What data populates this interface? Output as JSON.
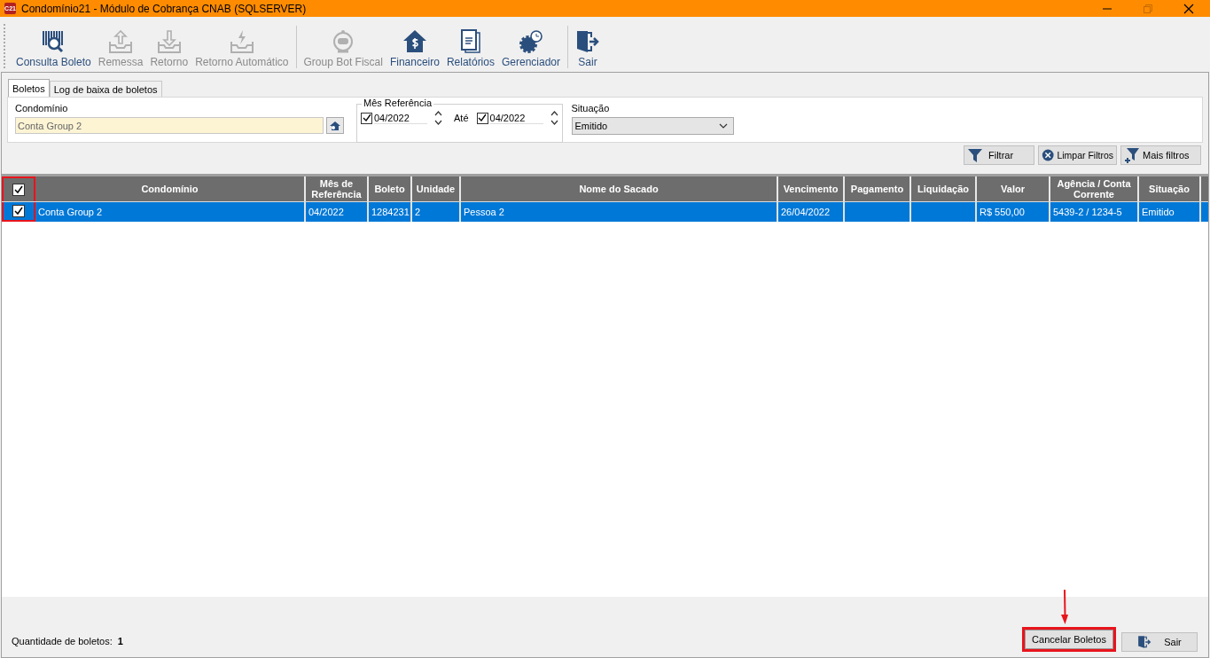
{
  "window": {
    "title": "Condomínio21 - Módulo de Cobrança CNAB (SQLSERVER)",
    "app_badge": "C21"
  },
  "toolbar": [
    {
      "label": "Consulta Boleto",
      "kind": "barcode",
      "disabled": false
    },
    {
      "label": "Remessa",
      "kind": "upload",
      "disabled": true
    },
    {
      "label": "Retorno",
      "kind": "download",
      "disabled": true
    },
    {
      "label": "Retorno Automático",
      "kind": "auto",
      "disabled": true
    },
    {
      "label": "Group Bot Fiscal",
      "kind": "robot",
      "disabled": true
    },
    {
      "label": "Financeiro",
      "kind": "house",
      "disabled": false
    },
    {
      "label": "Relatórios",
      "kind": "docs",
      "disabled": false
    },
    {
      "label": "Gerenciador",
      "kind": "gear",
      "disabled": false
    },
    {
      "label": "Sair",
      "kind": "exit",
      "disabled": false
    }
  ],
  "tabs": [
    {
      "label": "Boletos",
      "selected": true
    },
    {
      "label": "Log de baixa de boletos",
      "selected": false
    }
  ],
  "filters": {
    "condominio": {
      "label": "Condomínio",
      "value": "Conta Group 2"
    },
    "mes_referencia": {
      "label": "Mês Referência",
      "from": {
        "value": "04/2022",
        "checked": true
      },
      "to_label": "Até",
      "to": {
        "value": "04/2022",
        "checked": true
      }
    },
    "situacao": {
      "label": "Situação",
      "value": "Emitido"
    }
  },
  "filter_buttons": [
    {
      "label": "Filtrar",
      "kind": "filter"
    },
    {
      "label": "Limpar Filtros",
      "kind": "clear"
    },
    {
      "label": "Mais filtros",
      "kind": "more"
    }
  ],
  "table": {
    "select_all_checked": true,
    "checkbox_column_highlighted": true,
    "columns": [
      "Condomínio",
      "Mês de Referência",
      "Boleto",
      "Unidade",
      "Nome do Sacado",
      "Vencimento",
      "Pagamento",
      "Liquidação",
      "Valor",
      "Agência / Conta Corrente",
      "Situação"
    ],
    "rows": [
      {
        "checked": true,
        "selected": true,
        "cells": [
          "Conta Group 2",
          "04/2022",
          "1284231",
          "2",
          "Pessoa 2",
          "26/04/2022",
          "",
          "",
          "R$ 550,00",
          "5439-2 / 1234-5",
          "Emitido"
        ]
      }
    ]
  },
  "footer": {
    "count_label": "Quantidade de boletos:",
    "count": "1",
    "buttons": [
      {
        "label": "Cancelar Boletos",
        "kind": "plain",
        "highlighted": true
      },
      {
        "label": "Sair",
        "kind": "exit",
        "highlighted": false
      }
    ]
  }
}
